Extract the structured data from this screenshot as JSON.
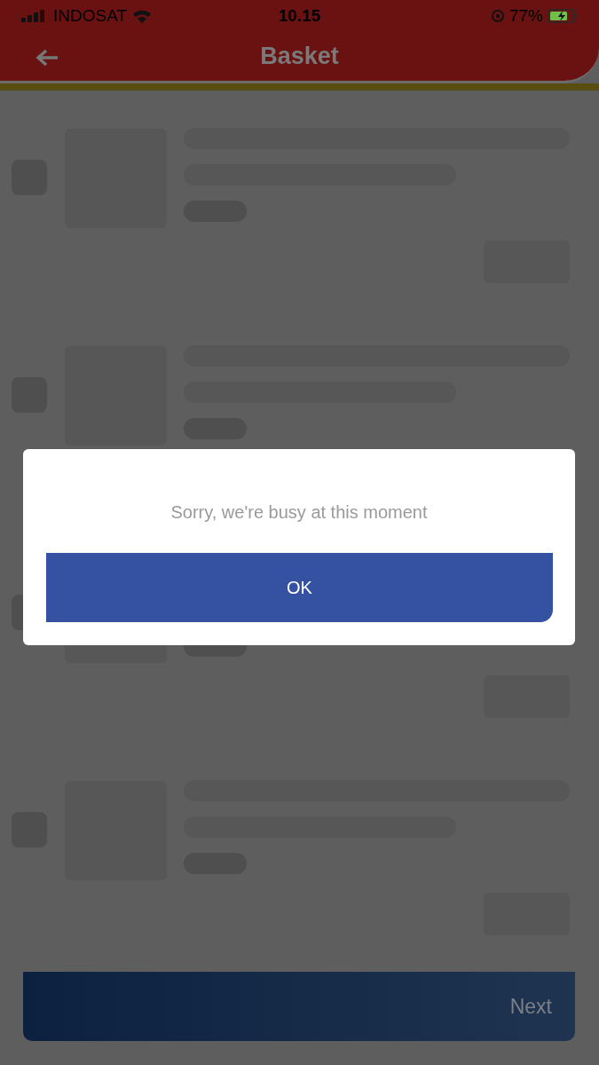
{
  "status_bar": {
    "carrier": "INDOSAT",
    "time": "10.15",
    "battery": "77%"
  },
  "header": {
    "title": "Basket"
  },
  "dialog": {
    "message": "Sorry, we're busy at this moment",
    "button": "OK"
  },
  "footer": {
    "button": "Next"
  }
}
